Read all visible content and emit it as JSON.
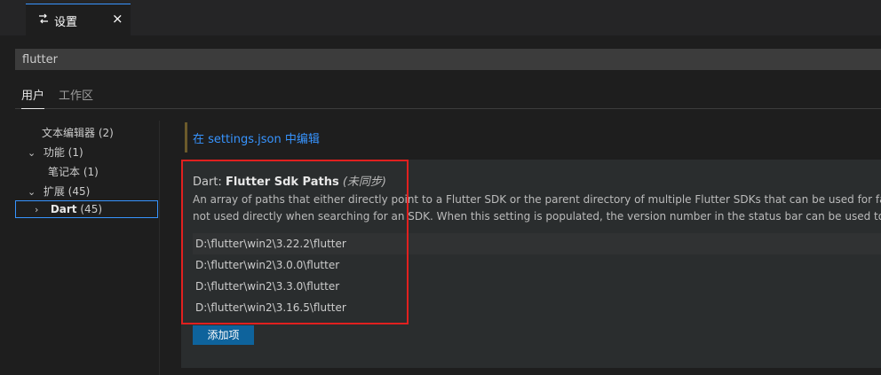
{
  "tab": {
    "icon": "settings-icon",
    "label": "设置",
    "close": "×"
  },
  "search": {
    "value": "flutter"
  },
  "scope_tabs": [
    {
      "label": "用户"
    },
    {
      "label": "工作区"
    }
  ],
  "toc": {
    "items": [
      {
        "label": "文本编辑器",
        "count": "(2)"
      },
      {
        "label": "功能",
        "count": "(1)"
      },
      {
        "label": "笔记本",
        "count": "(1)"
      },
      {
        "label": "扩展",
        "count": "(45)"
      },
      {
        "label": "Dart",
        "count": "(45)"
      }
    ]
  },
  "edit_link": "在 settings.json 中编辑",
  "setting": {
    "category": "Dart: ",
    "name": "Flutter Sdk Paths",
    "sync_note": "(未同步)",
    "description_line1": "An array of paths that either directly point to a Flutter SDK or the parent directory of multiple Flutter SDKs that can be used for fast SDK",
    "description_line2": "not used directly when searching for an SDK. When this setting is populated, the version number in the status bar can be used to quickly",
    "values": [
      "D:\\flutter\\win2\\3.22.2\\flutter",
      "D:\\flutter\\win2\\3.0.0\\flutter",
      "D:\\flutter\\win2\\3.3.0\\flutter",
      "D:\\flutter\\win2\\3.16.5\\flutter"
    ],
    "add_button": "添加项"
  },
  "colors": {
    "accent": "#3794ff",
    "button": "#0e639c",
    "highlight": "#e0201f"
  }
}
